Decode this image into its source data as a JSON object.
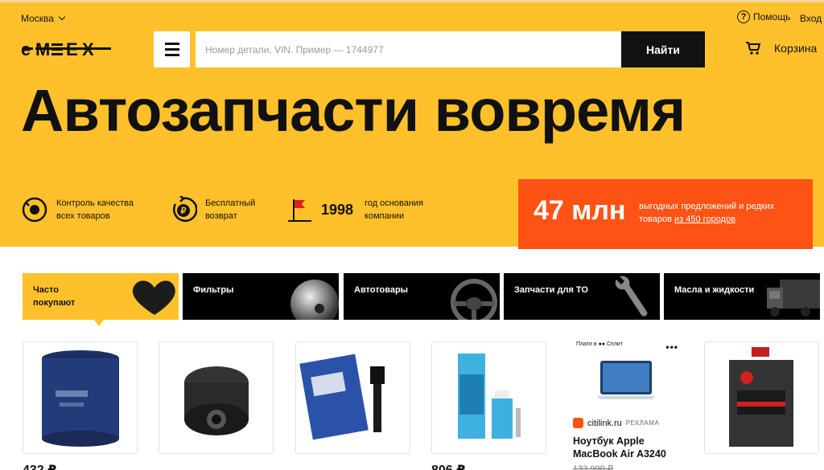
{
  "header": {
    "city": "Москва",
    "help": "Помощь",
    "login": "Вход",
    "logo": "EMEX",
    "search": {
      "placeholder": "Номер детали, VIN. Пример — 1744977",
      "button": "Найти"
    },
    "cart": "Корзина"
  },
  "hero": {
    "title": "Автозапчасти вовремя",
    "features": [
      {
        "icon": "quality-icon",
        "text": "Контроль качества всех товаров"
      },
      {
        "icon": "return-ruble-icon",
        "text": "Бесплатный возврат"
      },
      {
        "icon": "flag-icon",
        "value": "1998",
        "text": "год основания компании"
      }
    ],
    "promo": {
      "big": "47 млн",
      "text": "выгодных предложений и редких товаров",
      "link": "из 450 городов"
    }
  },
  "categories": [
    {
      "label": "Часто покупают",
      "icon": "heart-icon",
      "active": true
    },
    {
      "label": "Фильтры",
      "icon": "filter-icon",
      "active": false
    },
    {
      "label": "Автотовары",
      "icon": "steering-wheel-icon",
      "active": false
    },
    {
      "label": "Запчасти для ТО",
      "icon": "wrench-icon",
      "active": false
    },
    {
      "label": "Масла и жидкости",
      "icon": "truck-icon",
      "active": false
    }
  ],
  "products": [
    {
      "image": "oil-filter-blue",
      "price": "432 ₽"
    },
    {
      "image": "oil-filter-black",
      "price": ""
    },
    {
      "image": "ignition-coil",
      "price": ""
    },
    {
      "image": "sealant-tube",
      "price": "806 ₽"
    },
    {
      "image": "motor-oil-can",
      "price": ""
    }
  ],
  "ad": {
    "top": "Плати в ●● Сплит",
    "brand": "citilink.ru",
    "tag": "РЕКЛАМА",
    "title": "Ноутбук Apple MacBook Air A3240",
    "price": "133 990 ₽"
  },
  "colors": {
    "brand_yellow": "#ffc12b",
    "promo_orange": "#ff5315",
    "dark": "#111111"
  }
}
